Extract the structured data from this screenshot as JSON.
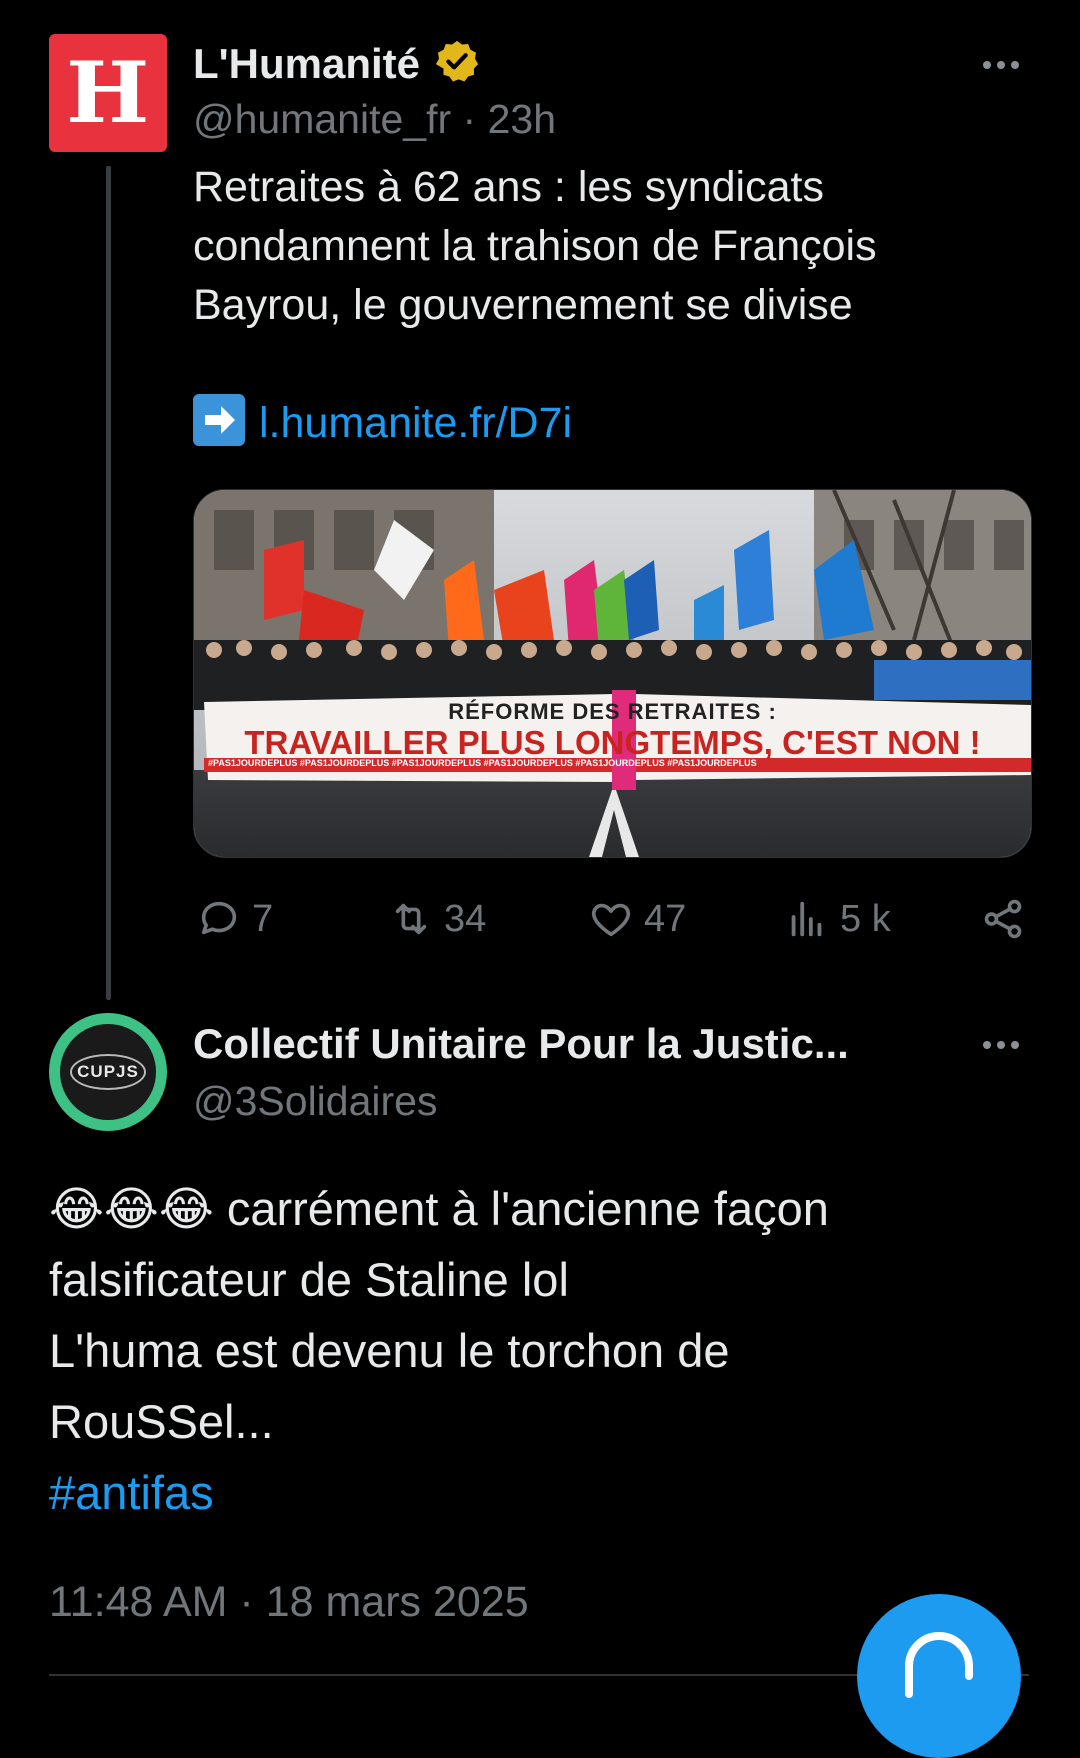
{
  "tweet1": {
    "avatar_letter": "H",
    "name": "L'Humanité",
    "handle": "@humanite_fr",
    "time": "23h",
    "text_lines": [
      "Retraites à 62 ans : les syndicats",
      "condamnent la trahison de François",
      "Bayrou, le gouvernement se divise"
    ],
    "link": "l.humanite.fr/D7i",
    "image_banner": {
      "line1": "RÉFORME DES RETRAITES :",
      "line2": "TRAVAILLER PLUS LONGTEMPS, C'EST NON !",
      "tags": "#PAS1JOURDEPLUS  #PAS1JOURDEPLUS  #PAS1JOURDEPLUS  #PAS1JOURDEPLUS  #PAS1JOURDEPLUS  #PAS1JOURDEPLUS"
    },
    "stats": {
      "replies": "7",
      "reposts": "34",
      "likes": "47",
      "views": "5 k"
    }
  },
  "tweet2": {
    "avatar_text": "CUPJS",
    "name": "Collectif Unitaire Pour la Justic...",
    "handle": "@3Solidaires",
    "emoji": "😂😂😂",
    "text_line1_rest": " carrément à l'ancienne façon",
    "text_line2": "falsificateur de Staline lol",
    "text_line3": "L'huma est devenu le torchon de",
    "text_line4": "RouSSel...",
    "hashtag": "#antifas",
    "timestamp": "11:48 AM · 18 mars 2025"
  },
  "colors": {
    "background": "#000000",
    "text": "#e7e9ea",
    "muted": "#71767b",
    "accent": "#1d9bf0",
    "humanite_red": "#e8333e",
    "verified_gold": "#e2b719",
    "cupjs_green": "#3ec184"
  },
  "icons": [
    "more-icon",
    "verified-badge-icon",
    "arrow-right-icon",
    "reply-icon",
    "repost-icon",
    "like-icon",
    "views-icon",
    "share-icon",
    "compose-icon"
  ]
}
